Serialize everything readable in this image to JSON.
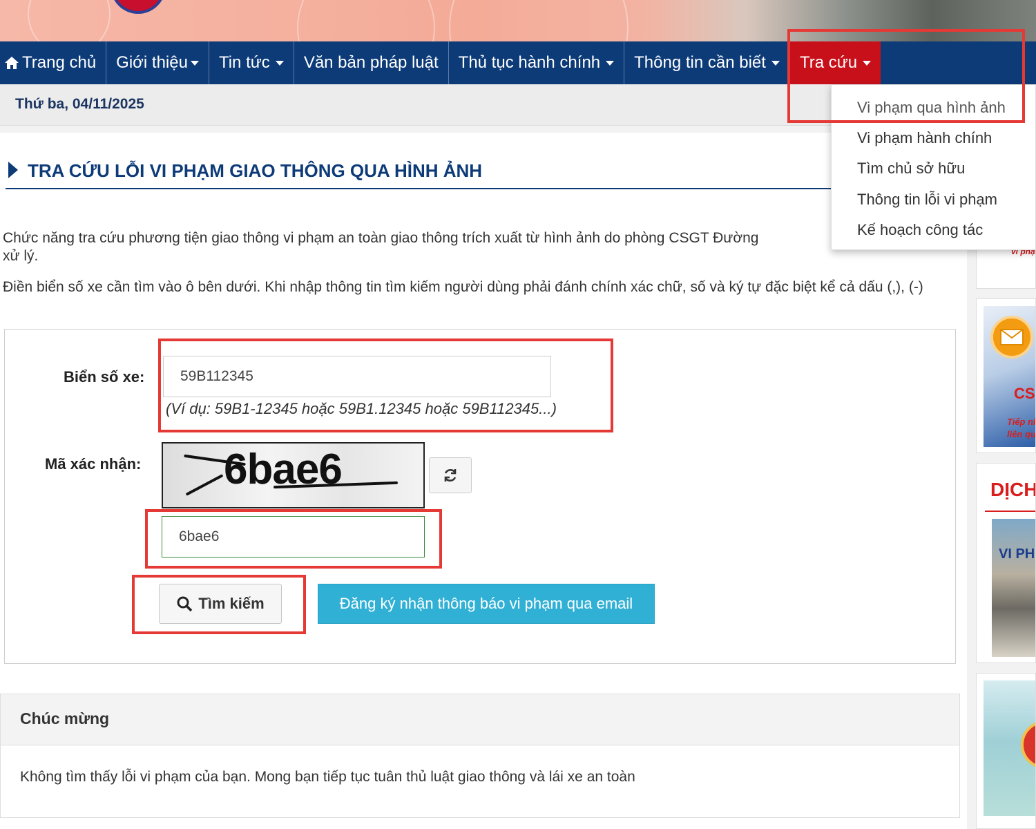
{
  "nav": {
    "items": [
      {
        "label": "Trang chủ",
        "icon": "home-icon"
      },
      {
        "label": "Giới thiệu"
      },
      {
        "label": "Tin tức"
      },
      {
        "label": "Văn bản pháp luật"
      },
      {
        "label": "Thủ tục hành chính"
      },
      {
        "label": "Thông tin cần biết"
      },
      {
        "label": "Tra cứu",
        "active": true
      }
    ],
    "active_color": "#c8101a",
    "bar_color": "#0d3b78"
  },
  "date": "Thứ ba, 04/11/2025",
  "dropdown": {
    "items": [
      "Vi phạm qua hình ảnh",
      "Vi phạm hành chính",
      "Tìm chủ sở hữu",
      "Thông tin lỗi vi phạm",
      "Kế hoạch công tác"
    ]
  },
  "page": {
    "title": "TRA CỨU LỖI VI PHẠM GIAO THÔNG QUA HÌNH ẢNH",
    "desc1": "Chức năng tra cứu phương tiện giao thông vi phạm an toàn giao thông trích xuất từ hình ảnh do phòng CSGT Đường",
    "desc1b": "xử lý.",
    "desc2": "Điền biển số xe cần tìm vào ô bên dưới. Khi nhập thông tin tìm kiếm người dùng phải đánh chính xác chữ, số và ký tự đặc biệt kể cả dấu (,), (-)"
  },
  "form": {
    "plate_label": "Biển số xe:",
    "plate_value": "59B112345",
    "plate_hint": "(Ví dụ: 59B1-12345 hoặc 59B1.12345 hoặc 59B112345...)",
    "captcha_label": "Mã xác nhận:",
    "captcha_image_text": "6bae6",
    "captcha_value": "6bae6",
    "search_label": "Tìm kiếm",
    "email_label": "Đăng ký nhận thông báo vi phạm qua email",
    "email_button_color": "#31b0d5"
  },
  "result": {
    "heading": "Chúc mừng",
    "message": "Không tìm thấy lỗi vi phạm của bạn. Mong bạn tiếp tục tuân thủ luật giao thông và lái xe an toàn"
  },
  "sidebar": {
    "card1_text": "vi phạ",
    "card2_text": "CSG",
    "card2_sub1": "Tiếp nh",
    "card2_sub2": "liên qu",
    "card3_title": "DỊCH",
    "card3_photo_text": "VI PH"
  },
  "annotation_color": "#e53935"
}
